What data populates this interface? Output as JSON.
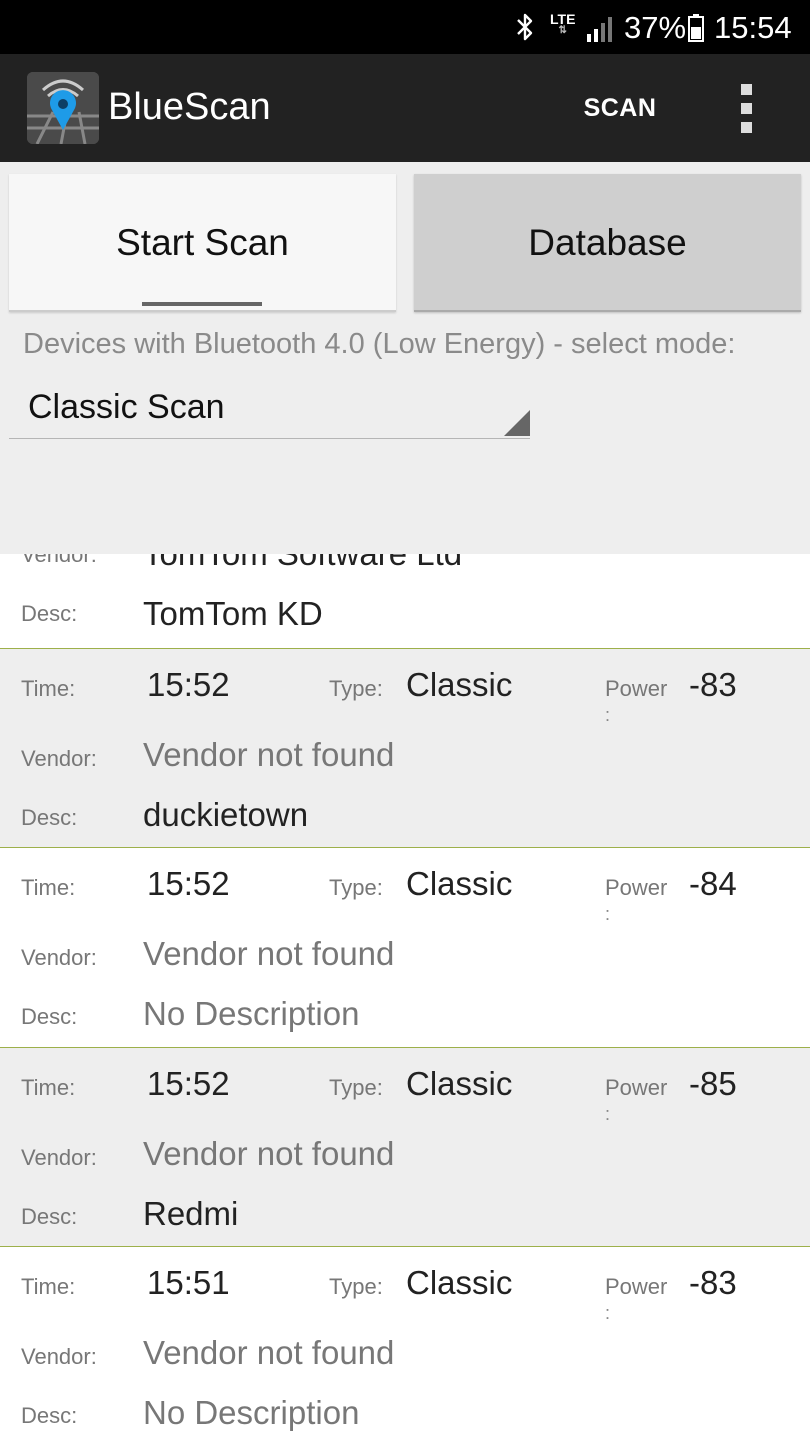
{
  "status_bar": {
    "network": "LTE",
    "battery": "37%",
    "time": "15:54",
    "icons": [
      "bluetooth-icon",
      "lte-icon",
      "signal-icon",
      "battery-icon"
    ]
  },
  "app_bar": {
    "title": "BlueScan",
    "scan_action": "SCAN",
    "icons": [
      "app-logo",
      "overflow-menu-icon"
    ]
  },
  "tabs": {
    "start_scan": "Start Scan",
    "database": "Database"
  },
  "mode": {
    "label": "Devices with Bluetooth 4.0 (Low Energy) - select mode:",
    "selected": "Classic Scan"
  },
  "labels": {
    "time": "Time:",
    "type": "Type:",
    "power": "Power",
    "power_colon": ":",
    "vendor": "Vendor:",
    "desc": "Desc:"
  },
  "devices": [
    {
      "time": "",
      "type": "",
      "power": "",
      "vendor": "TomTom Software Ltd",
      "desc": "TomTom KD"
    },
    {
      "time": "15:52",
      "type": "Classic",
      "power": "-83",
      "vendor": "Vendor not found",
      "desc": "duckietown"
    },
    {
      "time": "15:52",
      "type": "Classic",
      "power": "-84",
      "vendor": "Vendor not found",
      "desc": "No Description"
    },
    {
      "time": "15:52",
      "type": "Classic",
      "power": "-85",
      "vendor": "Vendor not found",
      "desc": "Redmi"
    },
    {
      "time": "15:51",
      "type": "Classic",
      "power": "-83",
      "vendor": "Vendor not found",
      "desc": "No Description"
    }
  ],
  "colors": {
    "app_bar": "#222222",
    "panel": "#eeeeee",
    "separator": "#9db04a",
    "logo_pin": "#1e9be8"
  }
}
